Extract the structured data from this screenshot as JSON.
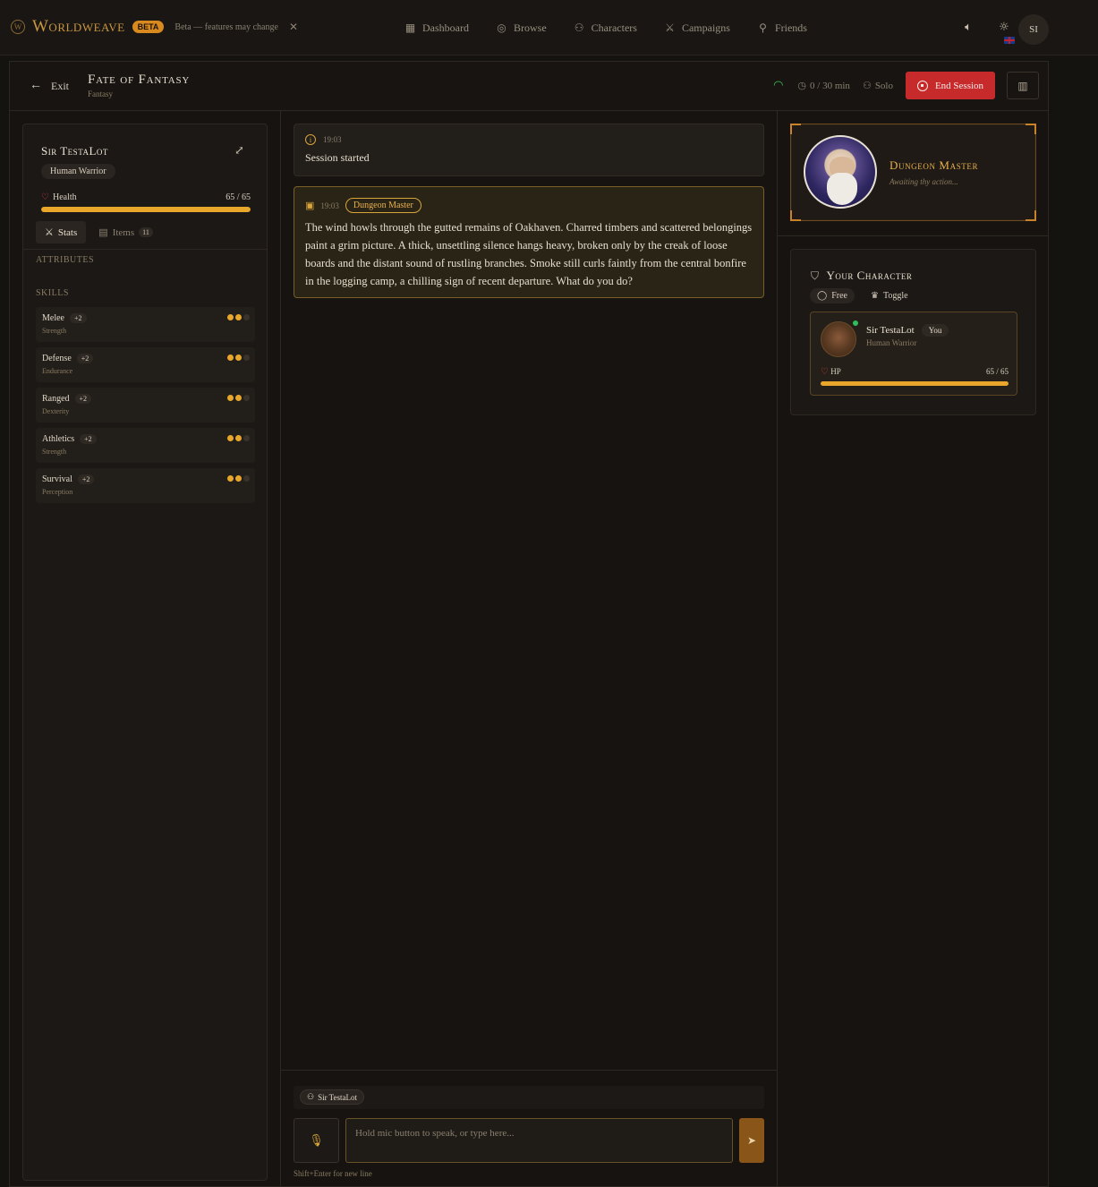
{
  "brand": {
    "name": "Worldweave",
    "badge": "BETA",
    "beta_note": "Beta — features may change"
  },
  "nav": {
    "items": [
      {
        "label": "Dashboard",
        "icon": "grid-icon"
      },
      {
        "label": "Browse",
        "icon": "compass-icon"
      },
      {
        "label": "Characters",
        "icon": "users-icon"
      },
      {
        "label": "Campaigns",
        "icon": "swords-icon"
      },
      {
        "label": "Friends",
        "icon": "user-plus-icon"
      }
    ]
  },
  "user": {
    "initials": "SI"
  },
  "session": {
    "exit_label": "Exit",
    "title": "Fate of Fantasy",
    "genre": "Fantasy",
    "timer": "0 / 30 min",
    "mode": "Solo",
    "end_label": "End Session"
  },
  "character": {
    "name": "Sir TestaLot",
    "race_class": "Human Warrior",
    "health_label": "Health",
    "health_value": "65 / 65",
    "health_fraction": 1.0,
    "tabs": {
      "stats": "Stats",
      "items": "Items",
      "items_count": "11"
    },
    "attributes_label": "ATTRIBUTES",
    "skills_label": "SKILLS",
    "skills": [
      {
        "name": "Melee",
        "mod": "+2",
        "attr": "Strength",
        "level": 2,
        "max": 3
      },
      {
        "name": "Defense",
        "mod": "+2",
        "attr": "Endurance",
        "level": 2,
        "max": 3
      },
      {
        "name": "Ranged",
        "mod": "+2",
        "attr": "Dexterity",
        "level": 2,
        "max": 3
      },
      {
        "name": "Athletics",
        "mod": "+2",
        "attr": "Strength",
        "level": 2,
        "max": 3
      },
      {
        "name": "Survival",
        "mod": "+2",
        "attr": "Perception",
        "level": 2,
        "max": 3
      }
    ]
  },
  "messages": {
    "system": {
      "time": "19:03",
      "text": "Session started"
    },
    "dm": {
      "time": "19:03",
      "badge": "Dungeon Master",
      "text": "The wind howls through the gutted remains of Oakhaven. Charred timbers and scattered belongings paint a grim picture. A thick, unsettling silence hangs heavy, broken only by the creak of loose boards and the distant sound of rustling branches. Smoke still curls faintly from the central bonfire in the logging camp, a chilling sign of recent departure. What do you do?"
    }
  },
  "composer": {
    "speaker": "Sir TestaLot",
    "placeholder": "Hold mic button to speak, or type here...",
    "hint": "Shift+Enter for new line"
  },
  "dm_panel": {
    "title": "Dungeon Master",
    "status": "Awaiting thy action..."
  },
  "your_character": {
    "title": "Your Character",
    "mode_free": "Free",
    "mode_toggle": "Toggle",
    "name": "Sir TestaLot",
    "you_tag": "You",
    "race_class": "Human Warrior",
    "hp_label": "HP",
    "hp_value": "65 / 65",
    "hp_fraction": 1.0
  },
  "colors": {
    "accent": "#e8a62a",
    "danger": "#c62a2a",
    "online": "#2fbf5a"
  }
}
